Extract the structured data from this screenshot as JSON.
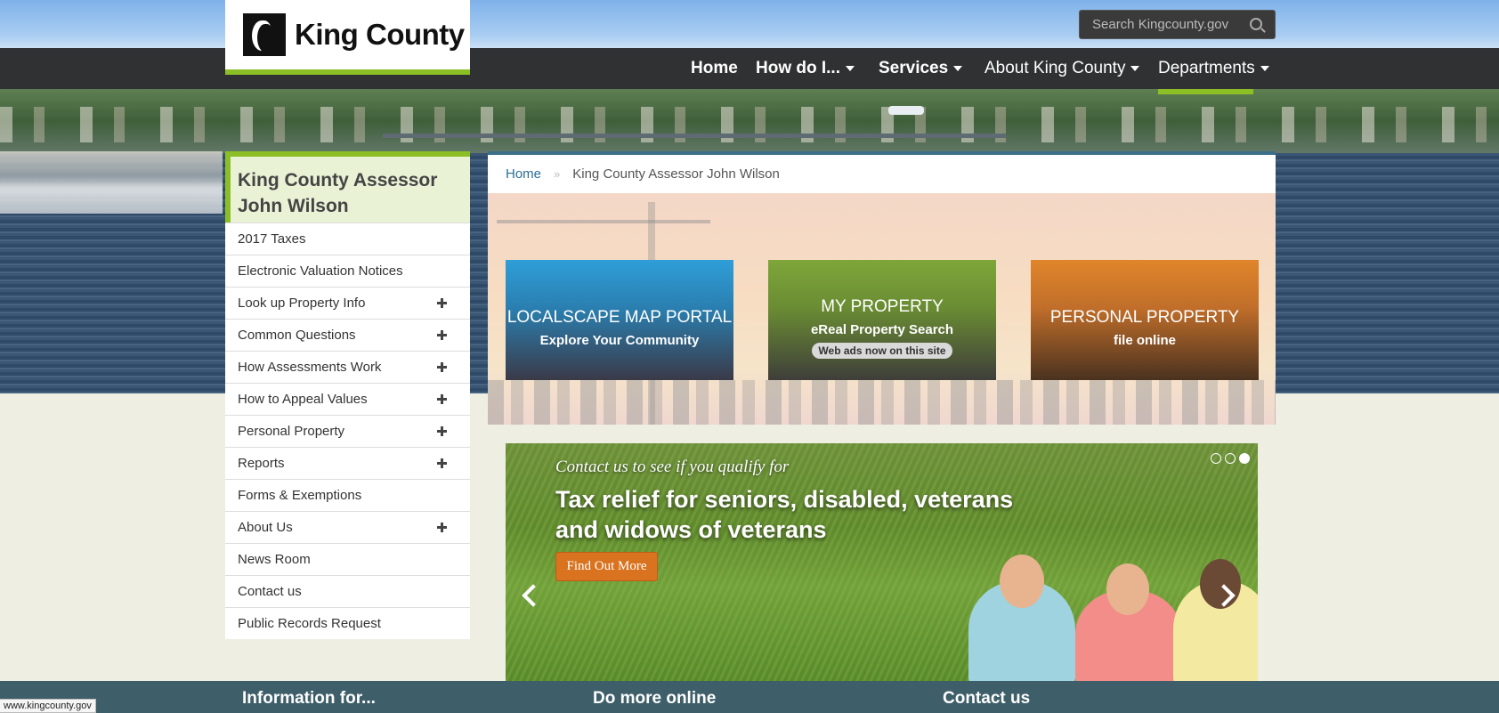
{
  "header": {
    "logo_text": "King County",
    "search_placeholder": "Search Kingcounty.gov",
    "nav": [
      {
        "label": "Home",
        "has_menu": false
      },
      {
        "label": "How do I...",
        "has_menu": true
      },
      {
        "label": "Services",
        "has_menu": true
      },
      {
        "label": "About King County",
        "has_menu": true
      },
      {
        "label": "Departments",
        "has_menu": true,
        "active": true
      }
    ]
  },
  "sidebar": {
    "title": "King County Assessor John Wilson",
    "items": [
      {
        "label": "2017 Taxes",
        "expandable": false
      },
      {
        "label": "Electronic Valuation Notices",
        "expandable": false
      },
      {
        "label": "Look up Property Info",
        "expandable": true
      },
      {
        "label": "Common Questions",
        "expandable": true
      },
      {
        "label": "How Assessments Work",
        "expandable": true
      },
      {
        "label": "How to Appeal Values",
        "expandable": true
      },
      {
        "label": "Personal Property",
        "expandable": true
      },
      {
        "label": "Reports",
        "expandable": true
      },
      {
        "label": "Forms & Exemptions",
        "expandable": false
      },
      {
        "label": "About Us",
        "expandable": true
      },
      {
        "label": "News Room",
        "expandable": false
      },
      {
        "label": "Contact us",
        "expandable": false
      },
      {
        "label": "Public Records Request",
        "expandable": false
      }
    ]
  },
  "breadcrumb": {
    "home": "Home",
    "separator": "»",
    "current": "King County Assessor John Wilson"
  },
  "tiles": [
    {
      "title": "LOCALSCAPE MAP PORTAL",
      "subtitle": "Explore Your Community",
      "badge": ""
    },
    {
      "title": "MY PROPERTY",
      "subtitle": "eReal Property Search",
      "badge": "Web ads now on this site"
    },
    {
      "title": "PERSONAL PROPERTY",
      "subtitle": "file online",
      "badge": ""
    }
  ],
  "banner": {
    "intro": "Contact us to see if you qualify for",
    "headline": "Tax relief for seniors, disabled, veterans and widows of veterans",
    "button": "Find Out More",
    "slide_count": 3,
    "active_slide": 3
  },
  "footer": {
    "columns": [
      "Information for...",
      "Do more online",
      "Contact us"
    ]
  },
  "status_bar": {
    "url": "www.kingcounty.gov"
  },
  "colors": {
    "accent_green": "#8cbf26",
    "header_dark": "#232323",
    "footer_teal": "#3e5f6a",
    "link_blue": "#2a6e97",
    "tile_blue": "#2f9ed8",
    "tile_green": "#7ea63a",
    "tile_orange": "#e0852b",
    "cta_orange": "#d9731f"
  }
}
